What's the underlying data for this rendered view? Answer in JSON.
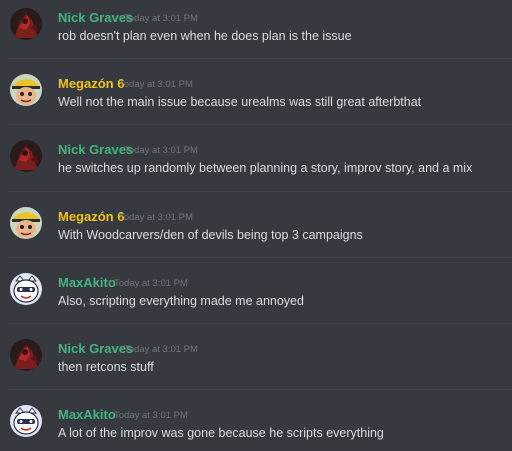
{
  "colors": {
    "background": "#36393f",
    "divider": "#3f4147",
    "timestamp": "#72767d",
    "text": "#dcddde"
  },
  "messages": [
    {
      "author": "Nick Graves",
      "author_color": "#43b581",
      "avatar": "dark-red-character-avatar",
      "timestamp": "Today at 3:01 PM",
      "text": "rob doesn't plan even when he does plan is the issue"
    },
    {
      "author": "Megazón 6",
      "author_color": "#f1c40f",
      "avatar": "yellow-hat-face-avatar",
      "timestamp": "Today at 3:01 PM",
      "text": "Well not the main issue because urealms was still great afterbthat"
    },
    {
      "author": "Nick Graves",
      "author_color": "#43b581",
      "avatar": "dark-red-character-avatar",
      "timestamp": "Today at 3:01 PM",
      "text": "he switches up randomly between planning a story, improv story, and a mix"
    },
    {
      "author": "Megazón 6",
      "author_color": "#f1c40f",
      "avatar": "yellow-hat-face-avatar",
      "timestamp": "Today at 3:01 PM",
      "text": "With Woodcarvers/den of devils being top 3 campaigns"
    },
    {
      "author": "MaxAkito",
      "author_color": "#43b581",
      "avatar": "white-cartoon-face-avatar",
      "timestamp": "Today at 3:01 PM",
      "text": "Also, scripting everything made me annoyed"
    },
    {
      "author": "Nick Graves",
      "author_color": "#43b581",
      "avatar": "dark-red-character-avatar",
      "timestamp": "Today at 3:01 PM",
      "text": "then retcons stuff"
    },
    {
      "author": "MaxAkito",
      "author_color": "#43b581",
      "avatar": "white-cartoon-face-avatar",
      "timestamp": "Today at 3:01 PM",
      "text": "A lot of the improv was gone because he scripts everything"
    }
  ]
}
